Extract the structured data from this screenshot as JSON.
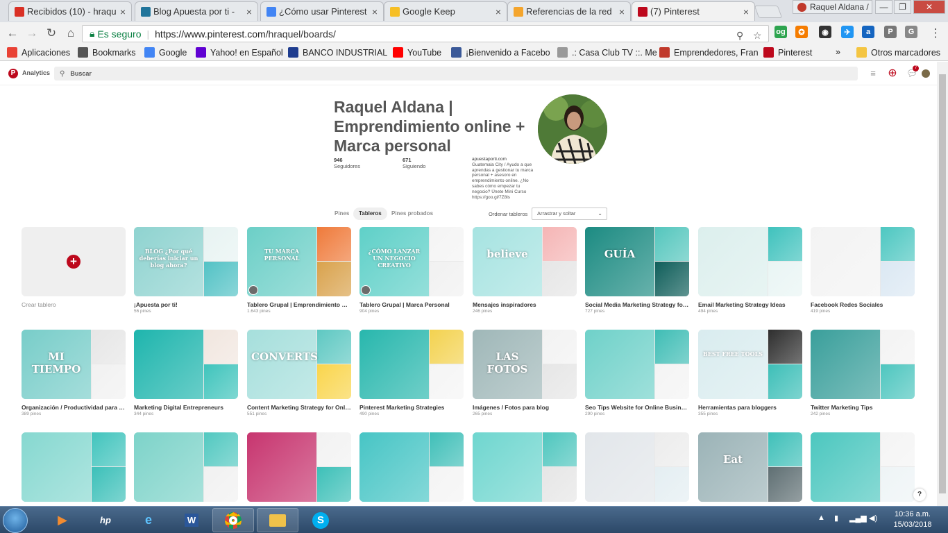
{
  "browser": {
    "tabs": [
      {
        "label": "Recibidos (10) - hraqu",
        "color": "#d93025"
      },
      {
        "label": "Blog Apuesta por ti - ",
        "color": "#21759b"
      },
      {
        "label": "¿Cómo usar Pinterest",
        "color": "#4285f4"
      },
      {
        "label": "Google Keep",
        "color": "#f6bf26"
      },
      {
        "label": "Referencias de la red",
        "color": "#f4a52d"
      },
      {
        "label": "(7) Pinterest",
        "color": "#bd081c"
      }
    ],
    "user_label": "Raquel Aldana /",
    "window_controls": {
      "minimize": "—",
      "restore": "❐",
      "close": "✕"
    },
    "secure_label": "Es seguro",
    "url_host": "https://www.pinterest.com",
    "url_path": "/hraquel/boards/",
    "bookmarks": [
      "Aplicaciones",
      "Bookmarks",
      "Google",
      "Yahoo! en Español",
      "BANCO INDUSTRIAL",
      "YouTube",
      "¡Bienvenido a Facebo",
      ".: Casa Club TV ::. Me",
      "Emprendedores, Fran",
      "Pinterest"
    ],
    "bookmarks_more": "»",
    "other_bookmarks": "Otros marcadores"
  },
  "pinterest": {
    "analytics_label": "Analytics",
    "search_placeholder": "Buscar",
    "notification_count": "7"
  },
  "profile": {
    "name": "Raquel Aldana | Emprendimiento online + Marca personal",
    "followers_count": "946",
    "followers_label": "Seguidores",
    "following_count": "671",
    "following_label": "Siguiendo",
    "website": "apuestaporti.com",
    "bio": "Guatemala City / Ayudo a que aprendas a gestionar tu marca personal + asesoro en emprendimiento online. ¿No sabes cómo empezar tu negocio? Únete Mini Curso https://goo.gl/7Z8ls"
  },
  "profile_tabs": [
    "Pines",
    "Tableros",
    "Pines probados"
  ],
  "sort": {
    "label": "Ordenar tableros",
    "value": "Arrastrar y soltar"
  },
  "create_board_label": "Crear tablero",
  "boards": [
    {
      "title": "¡Apuesta por ti!",
      "count": "56 pines",
      "c": [
        "#8fd3d0",
        "#e7f3f2",
        "#52c2c5"
      ],
      "text": "BLOG ¿Por qué deberías iniciar un blog ahora?"
    },
    {
      "title": "Tablero Grupal | Emprendimiento Online",
      "count": "1.643 pines",
      "c": [
        "#6ccfc7",
        "#ef7a3a",
        "#d9a24c"
      ],
      "text": "TU MARCA PERSONAL"
    },
    {
      "title": "Tablero Grupal | Marca Personal",
      "count": "904 pines",
      "c": [
        "#5fd0c8",
        "#f4f4f4",
        "#f1f1f1"
      ],
      "text": "¿CÓMO LANZAR UN NEGOCIO CREATIVO"
    },
    {
      "title": "Mensajes inspiradores",
      "count": "246 pines",
      "c": [
        "#a6e3e1",
        "#f5b5b5",
        "#e6e6e6"
      ],
      "text": "believe"
    },
    {
      "title": "Social Media Marketing Strategy for Online Business",
      "count": "727 pines",
      "c": [
        "#1c8b82",
        "#54c6bd",
        "#0f5e5a"
      ],
      "text": "GUÍA"
    },
    {
      "title": "Email Marketing Strategy Ideas",
      "count": "494 pines",
      "c": [
        "#dcefed",
        "#3fc2bd",
        "#e9f5f4"
      ],
      "text": ""
    },
    {
      "title": "Facebook Redes Sociales",
      "count": "419 pines",
      "c": [
        "#f3f3f3",
        "#4dc7c1",
        "#dbe8f3"
      ],
      "text": ""
    },
    {
      "title": "Organización / Productividad para emprendedores",
      "count": "389 pines",
      "c": [
        "#78cdc9",
        "#e6e6e6",
        "#f1f1f1"
      ],
      "text": "MI TIEMPO"
    },
    {
      "title": "Marketing Digital Entrepreneurs",
      "count": "344 pines",
      "c": [
        "#1eb5ad",
        "#f1e6df",
        "#3fc4bc"
      ],
      "text": ""
    },
    {
      "title": "Content Marketing Strategy for Online Business",
      "count": "551 pines",
      "c": [
        "#a6dfdc",
        "#5ec8c2",
        "#f9d54c"
      ],
      "text": "CONVERTS"
    },
    {
      "title": "Pinterest Marketing Strategies",
      "count": "490 pines",
      "c": [
        "#28b7ad",
        "#f3d24f",
        "#f5f5f5"
      ],
      "text": ""
    },
    {
      "title": "Imágenes / Fotos para blog",
      "count": "265 pines",
      "c": [
        "#9fb7b8",
        "#f2f2f2",
        "#e6e6e6"
      ],
      "text": "LAS FOTOS"
    },
    {
      "title": "Seo Tips Website for Online Business",
      "count": "290 pines",
      "c": [
        "#6fd1c9",
        "#3fbdb5",
        "#f4f4f4"
      ],
      "text": ""
    },
    {
      "title": "Herramientas para bloggers",
      "count": "355 pines",
      "c": [
        "#d9ecef",
        "#2e2e2e",
        "#3dbfb8"
      ],
      "text": "BEST FREE TOOLS"
    },
    {
      "title": "Twitter Marketing Tips",
      "count": "242 pines",
      "c": [
        "#3a9f9b",
        "#f3f3f3",
        "#4ec6bf"
      ],
      "text": ""
    },
    {
      "title": "",
      "count": "",
      "c": [
        "#86d8d0",
        "#41c4bd",
        "#3cc0b9"
      ],
      "text": ""
    },
    {
      "title": "",
      "count": "",
      "c": [
        "#7dd3c9",
        "#51c8c0",
        "#f1f1f1"
      ],
      "text": ""
    },
    {
      "title": "",
      "count": "",
      "c": [
        "#c7356f",
        "#f2f2f2",
        "#3dc0b8"
      ],
      "text": ""
    },
    {
      "title": "",
      "count": "",
      "c": [
        "#47c5c5",
        "#3fbfb8",
        "#f4f4f4"
      ],
      "text": ""
    },
    {
      "title": "",
      "count": "",
      "c": [
        "#6fd6cf",
        "#4ec6be",
        "#e6e6e6"
      ],
      "text": ""
    },
    {
      "title": "",
      "count": "",
      "c": [
        "#e2e6ea",
        "#ececec",
        "#e4eef2"
      ],
      "text": ""
    },
    {
      "title": "",
      "count": "",
      "c": [
        "#9bb3b7",
        "#3fc0b9",
        "#5f6f73"
      ],
      "text": "Eat"
    },
    {
      "title": "",
      "count": "",
      "c": [
        "#4cc7bf",
        "#f4f4f4",
        "#eef4f6"
      ],
      "text": ""
    }
  ],
  "help_label": "?",
  "taskbar": {
    "time": "10:36 a.m.",
    "date": "15/03/2018"
  }
}
